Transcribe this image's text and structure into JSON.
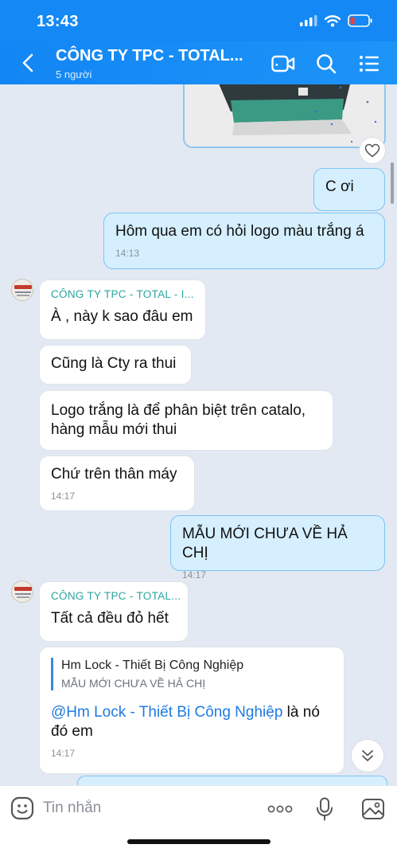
{
  "status": {
    "time": "13:43"
  },
  "header": {
    "title": "CÔNG TY TPC - TOTAL...",
    "subtitle": "5 người"
  },
  "messages": {
    "m1": {
      "text": "C ơi"
    },
    "m2": {
      "text": "Hôm qua em có hỏi logo màu trắng á",
      "time": "14:13"
    },
    "m3": {
      "sender": "CÔNG TY TPC - TOTAL - I...",
      "text": "À , này k sao đâu em"
    },
    "m4": {
      "text": "Cũng là Cty ra thui"
    },
    "m5": {
      "line1": "Logo trắng là để phân biệt trên catalo,",
      "line2": "hàng mẫu mới thui"
    },
    "m6": {
      "text": "Chứ trên thân máy",
      "time": "14:17"
    },
    "m7": {
      "text": "MẪU MỚI CHƯA VỀ HẢ CHỊ",
      "time": "14:17"
    },
    "m8": {
      "sender": "CÔNG TY TPC - TOTAL...",
      "text": "Tất cả đều đỏ hết"
    },
    "m9": {
      "quote_name": "Hm Lock - Thiết Bị Công Nghiệp",
      "quote_text": "MẪU MỚI CHƯA VỀ HẢ CHỊ",
      "mention": "@Hm Lock - Thiết Bị Công Nghiệp",
      "text_after": " là nó",
      "line2": "đó em",
      "time": "14:17"
    }
  },
  "input": {
    "placeholder": "Tin nhắn"
  },
  "icons": {
    "back": "chevron-left-icon",
    "video": "video-call-icon",
    "search": "search-icon",
    "menu": "list-menu-icon",
    "heart": "heart-icon",
    "emoji": "emoji-icon",
    "more": "more-dots-icon",
    "mic": "microphone-icon",
    "image": "image-icon"
  },
  "colors": {
    "brand_blue": "#1489f5",
    "outgoing_bubble": "#d5efff",
    "sender_name": "#2aa59e",
    "mention": "#1f7be0"
  }
}
